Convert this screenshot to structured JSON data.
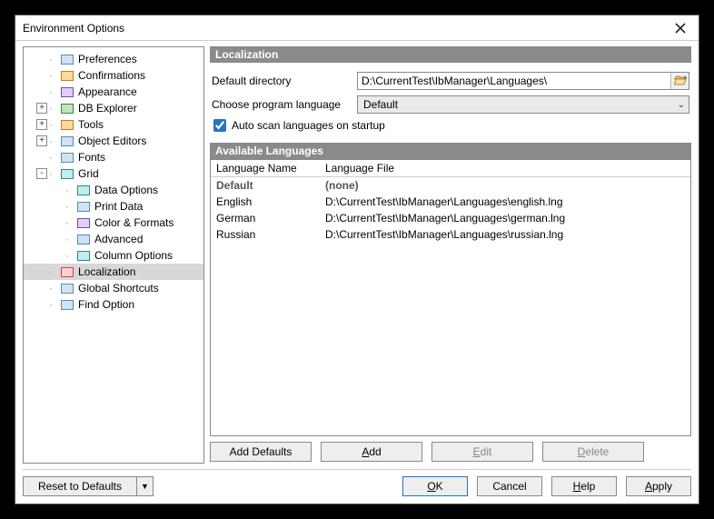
{
  "window": {
    "title": "Environment Options"
  },
  "tree": {
    "items": [
      {
        "label": "Preferences",
        "level": 0,
        "exp": "...",
        "iconCls": "ico-box"
      },
      {
        "label": "Confirmations",
        "level": 0,
        "exp": "...",
        "iconCls": "ico-box orange"
      },
      {
        "label": "Appearance",
        "level": 0,
        "exp": "...",
        "iconCls": "ico-box purple"
      },
      {
        "label": "DB Explorer",
        "level": 0,
        "exp": "+",
        "iconCls": "ico-box green"
      },
      {
        "label": "Tools",
        "level": 0,
        "exp": "+",
        "iconCls": "ico-box orange"
      },
      {
        "label": "Object Editors",
        "level": 0,
        "exp": "+",
        "iconCls": "ico-box"
      },
      {
        "label": "Fonts",
        "level": 0,
        "exp": "...",
        "iconCls": "ico-box"
      },
      {
        "label": "Grid",
        "level": 0,
        "exp": "-",
        "iconCls": "ico-box teal"
      },
      {
        "label": "Data Options",
        "level": 1,
        "exp": "...",
        "iconCls": "ico-box teal"
      },
      {
        "label": "Print Data",
        "level": 1,
        "exp": "...",
        "iconCls": "ico-box"
      },
      {
        "label": "Color & Formats",
        "level": 1,
        "exp": "...",
        "iconCls": "ico-box purple"
      },
      {
        "label": "Advanced",
        "level": 1,
        "exp": "...",
        "iconCls": "ico-box"
      },
      {
        "label": "Column Options",
        "level": 1,
        "exp": "...",
        "iconCls": "ico-box teal"
      },
      {
        "label": "Localization",
        "level": 0,
        "exp": "...",
        "iconCls": "ico-box red",
        "selected": true
      },
      {
        "label": "Global Shortcuts",
        "level": 0,
        "exp": "...",
        "iconCls": "ico-box"
      },
      {
        "label": "Find Option",
        "level": 0,
        "exp": "...",
        "iconCls": "ico-box"
      }
    ]
  },
  "localization": {
    "section_title": "Localization",
    "default_dir_label": "Default directory",
    "default_dir_value": "D:\\CurrentTest\\IbManager\\Languages\\",
    "choose_lang_label": "Choose program language",
    "choose_lang_value": "Default",
    "auto_scan_label": "Auto scan languages on startup",
    "auto_scan_checked": true
  },
  "avail": {
    "title": "Available Languages",
    "col1": "Language Name",
    "col2": "Language File",
    "rows": [
      {
        "name": "Default",
        "file": "(none)",
        "bold": true
      },
      {
        "name": "English",
        "file": "D:\\CurrentTest\\IbManager\\Languages\\english.lng"
      },
      {
        "name": "German",
        "file": "D:\\CurrentTest\\IbManager\\Languages\\german.lng"
      },
      {
        "name": "Russian",
        "file": "D:\\CurrentTest\\IbManager\\Languages\\russian.lng"
      }
    ]
  },
  "buttons": {
    "add_defaults": "Add Defaults",
    "add": "Add",
    "edit": "Edit",
    "delete": "Delete"
  },
  "footer": {
    "reset": "Reset to Defaults",
    "ok": "OK",
    "cancel": "Cancel",
    "help": "Help",
    "apply": "Apply"
  }
}
